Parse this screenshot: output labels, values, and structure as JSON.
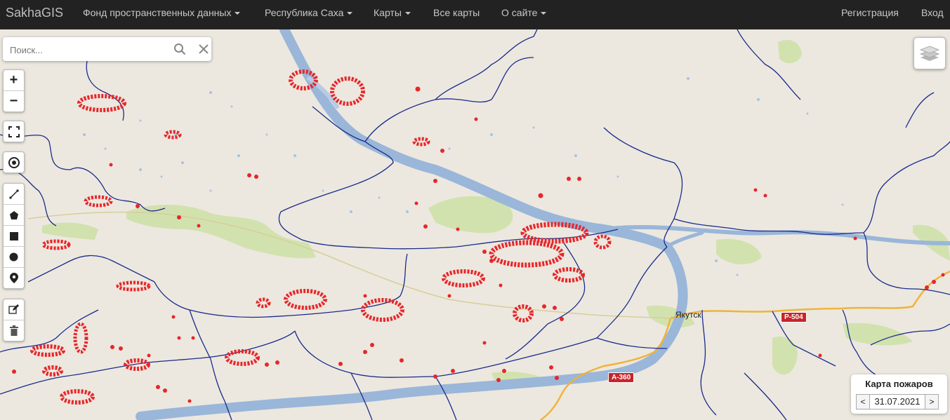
{
  "navbar": {
    "brand": "SakhaGIS",
    "menu": [
      {
        "label": "Фонд пространственных данных",
        "dropdown": true
      },
      {
        "label": "Республика Саха",
        "dropdown": true
      },
      {
        "label": "Карты",
        "dropdown": true
      },
      {
        "label": "Все карты",
        "dropdown": false
      },
      {
        "label": "О сайте",
        "dropdown": true
      }
    ],
    "register": "Регистрация",
    "login": "Вход"
  },
  "search": {
    "placeholder": "Поиск..."
  },
  "map": {
    "city_label": "Якутск",
    "road_labels": [
      "Р-504",
      "А-360"
    ]
  },
  "fire_panel": {
    "title": "Карта пожаров",
    "date": "31.07.2021",
    "prev": "<",
    "next": ">"
  },
  "colors": {
    "fire": "#e8262a",
    "river": "#9ab6d9",
    "border": "#1a2a8c",
    "navbar": "#222222"
  }
}
